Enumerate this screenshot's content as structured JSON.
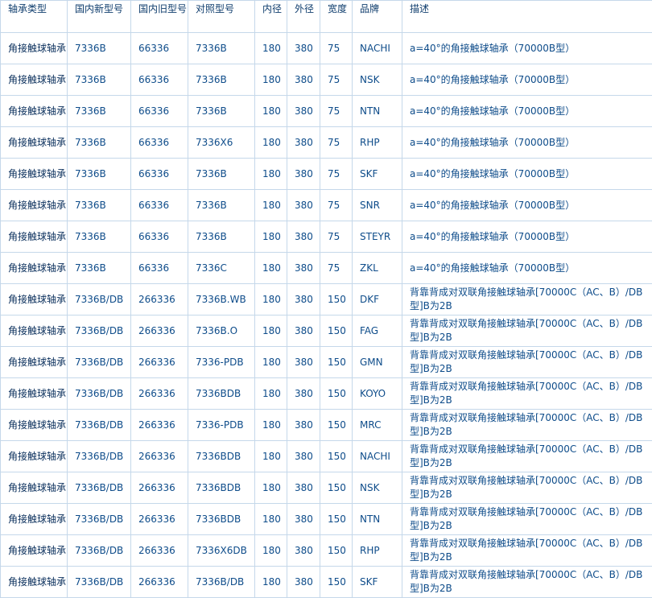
{
  "headers": {
    "type": "轴承类型",
    "new_model": "国内新型号",
    "old_model": "国内旧型号",
    "ref_model": "对照型号",
    "inner": "内径",
    "outer": "外径",
    "width": "宽度",
    "brand": "品牌",
    "desc": "描述"
  },
  "rows": [
    {
      "type": "角接触球轴承",
      "new_model": "7336B",
      "old_model": "66336",
      "ref_model": "7336B",
      "inner": "180",
      "outer": "380",
      "width": "75",
      "brand": "NACHI",
      "desc": "a=40°的角接触球轴承（70000B型）"
    },
    {
      "type": "角接触球轴承",
      "new_model": "7336B",
      "old_model": "66336",
      "ref_model": "7336B",
      "inner": "180",
      "outer": "380",
      "width": "75",
      "brand": "NSK",
      "desc": "a=40°的角接触球轴承（70000B型）"
    },
    {
      "type": "角接触球轴承",
      "new_model": "7336B",
      "old_model": "66336",
      "ref_model": "7336B",
      "inner": "180",
      "outer": "380",
      "width": "75",
      "brand": "NTN",
      "desc": "a=40°的角接触球轴承（70000B型）"
    },
    {
      "type": "角接触球轴承",
      "new_model": "7336B",
      "old_model": "66336",
      "ref_model": "7336X6",
      "inner": "180",
      "outer": "380",
      "width": "75",
      "brand": "RHP",
      "desc": "a=40°的角接触球轴承（70000B型）"
    },
    {
      "type": "角接触球轴承",
      "new_model": "7336B",
      "old_model": "66336",
      "ref_model": "7336B",
      "inner": "180",
      "outer": "380",
      "width": "75",
      "brand": "SKF",
      "desc": "a=40°的角接触球轴承（70000B型）"
    },
    {
      "type": "角接触球轴承",
      "new_model": "7336B",
      "old_model": "66336",
      "ref_model": "7336B",
      "inner": "180",
      "outer": "380",
      "width": "75",
      "brand": "SNR",
      "desc": "a=40°的角接触球轴承（70000B型）"
    },
    {
      "type": "角接触球轴承",
      "new_model": "7336B",
      "old_model": "66336",
      "ref_model": "7336B",
      "inner": "180",
      "outer": "380",
      "width": "75",
      "brand": "STEYR",
      "desc": "a=40°的角接触球轴承（70000B型）"
    },
    {
      "type": "角接触球轴承",
      "new_model": "7336B",
      "old_model": "66336",
      "ref_model": "7336C",
      "inner": "180",
      "outer": "380",
      "width": "75",
      "brand": "ZKL",
      "desc": "a=40°的角接触球轴承（70000B型）"
    },
    {
      "type": "角接触球轴承",
      "new_model": "7336B/DB",
      "old_model": "266336",
      "ref_model": "7336B.WB",
      "inner": "180",
      "outer": "380",
      "width": "150",
      "brand": "DKF",
      "desc": "背靠背成对双联角接触球轴承[70000C（AC、B）/DB型]B为2B"
    },
    {
      "type": "角接触球轴承",
      "new_model": "7336B/DB",
      "old_model": "266336",
      "ref_model": "7336B.O",
      "inner": "180",
      "outer": "380",
      "width": "150",
      "brand": "FAG",
      "desc": "背靠背成对双联角接触球轴承[70000C（AC、B）/DB型]B为2B"
    },
    {
      "type": "角接触球轴承",
      "new_model": "7336B/DB",
      "old_model": "266336",
      "ref_model": "7336-PDB",
      "inner": "180",
      "outer": "380",
      "width": "150",
      "brand": "GMN",
      "desc": "背靠背成对双联角接触球轴承[70000C（AC、B）/DB型]B为2B"
    },
    {
      "type": "角接触球轴承",
      "new_model": "7336B/DB",
      "old_model": "266336",
      "ref_model": "7336BDB",
      "inner": "180",
      "outer": "380",
      "width": "150",
      "brand": "KOYO",
      "desc": "背靠背成对双联角接触球轴承[70000C（AC、B）/DB型]B为2B"
    },
    {
      "type": "角接触球轴承",
      "new_model": "7336B/DB",
      "old_model": "266336",
      "ref_model": "7336-PDB",
      "inner": "180",
      "outer": "380",
      "width": "150",
      "brand": "MRC",
      "desc": "背靠背成对双联角接触球轴承[70000C（AC、B）/DB型]B为2B"
    },
    {
      "type": "角接触球轴承",
      "new_model": "7336B/DB",
      "old_model": "266336",
      "ref_model": "7336BDB",
      "inner": "180",
      "outer": "380",
      "width": "150",
      "brand": "NACHI",
      "desc": "背靠背成对双联角接触球轴承[70000C（AC、B）/DB型]B为2B"
    },
    {
      "type": "角接触球轴承",
      "new_model": "7336B/DB",
      "old_model": "266336",
      "ref_model": "7336BDB",
      "inner": "180",
      "outer": "380",
      "width": "150",
      "brand": "NSK",
      "desc": "背靠背成对双联角接触球轴承[70000C（AC、B）/DB型]B为2B"
    },
    {
      "type": "角接触球轴承",
      "new_model": "7336B/DB",
      "old_model": "266336",
      "ref_model": "7336BDB",
      "inner": "180",
      "outer": "380",
      "width": "150",
      "brand": "NTN",
      "desc": "背靠背成对双联角接触球轴承[70000C（AC、B）/DB型]B为2B"
    },
    {
      "type": "角接触球轴承",
      "new_model": "7336B/DB",
      "old_model": "266336",
      "ref_model": "7336X6DB",
      "inner": "180",
      "outer": "380",
      "width": "150",
      "brand": "RHP",
      "desc": "背靠背成对双联角接触球轴承[70000C（AC、B）/DB型]B为2B"
    },
    {
      "type": "角接触球轴承",
      "new_model": "7336B/DB",
      "old_model": "266336",
      "ref_model": "7336B/DB",
      "inner": "180",
      "outer": "380",
      "width": "150",
      "brand": "SKF",
      "desc": "背靠背成对双联角接触球轴承[70000C（AC、B）/DB型]B为2B"
    }
  ]
}
